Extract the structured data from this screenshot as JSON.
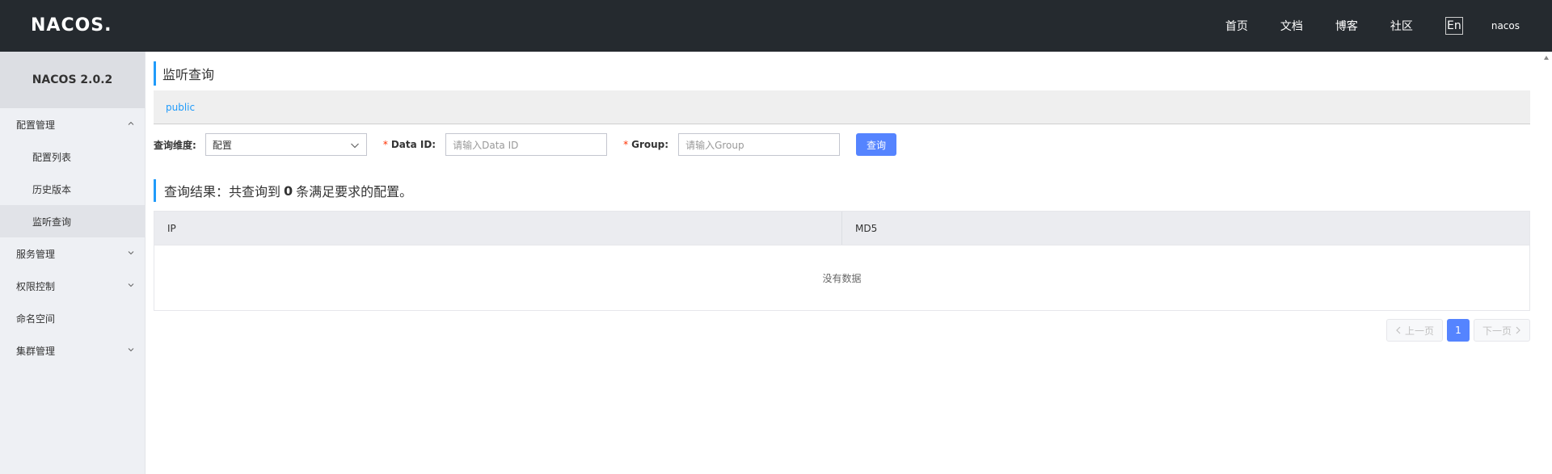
{
  "topbar": {
    "logo_text": "NACOS",
    "logo_dot": ".",
    "nav": [
      "首页",
      "文档",
      "博客",
      "社区"
    ],
    "lang": "En",
    "user": "nacos"
  },
  "sidebar": {
    "title": "NACOS 2.0.2",
    "config_group": "配置管理",
    "config_items": [
      "配置列表",
      "历史版本",
      "监听查询"
    ],
    "service_group": "服务管理",
    "auth_group": "权限控制",
    "namespace": "命名空间",
    "cluster_group": "集群管理"
  },
  "main": {
    "page_title": "监听查询",
    "namespace": "public",
    "form": {
      "dimension_label": "查询维度:",
      "dimension_value": "配置",
      "req_mark": "*",
      "dataid_label": "Data ID:",
      "dataid_placeholder": "请输入Data ID",
      "group_label": "Group:",
      "group_placeholder": "请输入Group",
      "query_button": "查询"
    },
    "result": {
      "prefix": "查询结果：共查询到",
      "count": "0",
      "suffix": "条满足要求的配置。"
    },
    "table": {
      "columns": [
        "IP",
        "MD5"
      ],
      "empty_text": "没有数据"
    },
    "pager": {
      "prev": "上一页",
      "current": "1",
      "next": "下一页"
    }
  },
  "colors": {
    "topbar_bg": "#252a2f",
    "accent": "#209bfa",
    "primary_button": "#5584ff"
  }
}
